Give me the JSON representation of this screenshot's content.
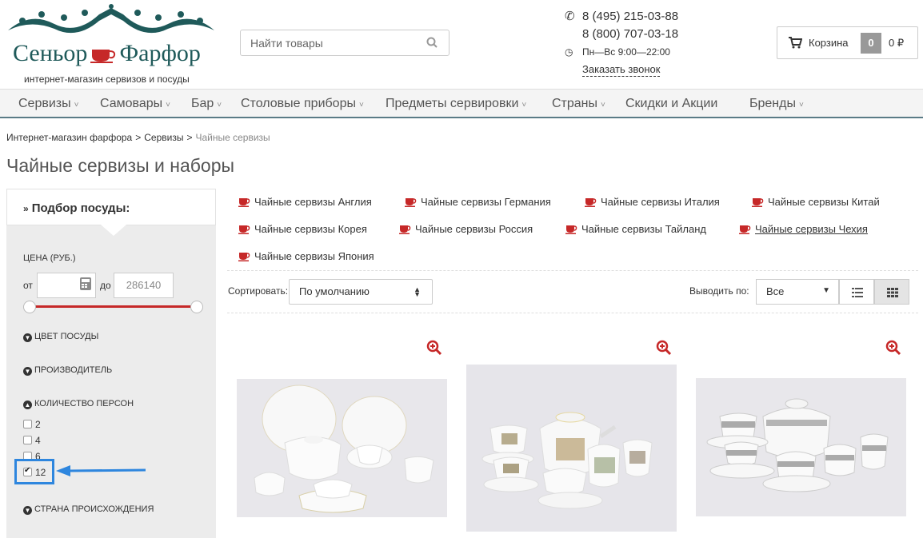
{
  "logo": {
    "title_left": "Сеньор",
    "title_right": "Фарфор",
    "subtitle": "интернет-магазин сервизов и посуды"
  },
  "search": {
    "placeholder": "Найти товары"
  },
  "contacts": {
    "phone1": "8 (495) 215-03-88",
    "phone2": "8 (800) 707-03-18",
    "hours": "Пн—Вс 9:00—22:00",
    "callback": "Заказать звонок"
  },
  "cart": {
    "label": "Корзина",
    "count": "0",
    "sum": "0 ₽"
  },
  "nav": [
    {
      "label": "Сервизы",
      "caret": "˅"
    },
    {
      "label": "Самовары",
      "caret": "˅"
    },
    {
      "label": "Бар",
      "caret": "˅"
    },
    {
      "label": "Столовые приборы",
      "caret": "˅"
    },
    {
      "label": "Предметы сервировки",
      "caret": "˅"
    },
    {
      "label": "Страны",
      "caret": "˅"
    },
    {
      "label": "Скидки и Акции",
      "caret": ""
    },
    {
      "label": "Бренды",
      "caret": "˅"
    }
  ],
  "breadcrumb": {
    "home": "Интернет-магазин фарфора",
    "section": "Сервизы",
    "current": "Чайные сервизы",
    "sep": ">"
  },
  "page_title": "Чайные сервизы и наборы",
  "sidebar": {
    "heading": "Подбор посуды:",
    "price_label": "ЦЕНА (РУБ.)",
    "from": "от",
    "to": "до",
    "to_placeholder": "286140",
    "filters": {
      "color": "ЦВЕТ ПОСУДЫ",
      "maker": "ПРОИЗВОДИТЕЛЬ",
      "persons": "КОЛИЧЕСТВО ПЕРСОН",
      "country": "СТРАНА ПРОИСХОЖДЕНИЯ"
    },
    "persons_options": [
      "2",
      "4",
      "6",
      "12"
    ]
  },
  "categories": [
    "Чайные сервизы Англия",
    "Чайные сервизы Германия",
    "Чайные сервизы Италия",
    "Чайные сервизы Китай",
    "Чайные сервизы Корея",
    "Чайные сервизы Россия",
    "Чайные сервизы Тайланд",
    "Чайные сервизы Чехия",
    "Чайные сервизы Япония"
  ],
  "toolbar": {
    "sort_label": "Сортировать:",
    "sort_value": "По умолчанию",
    "per_label": "Выводить по:",
    "per_value": "Все"
  },
  "colors": {
    "brand": "#1f5a5a",
    "accent": "#c62828",
    "highlight": "#2e86de"
  }
}
